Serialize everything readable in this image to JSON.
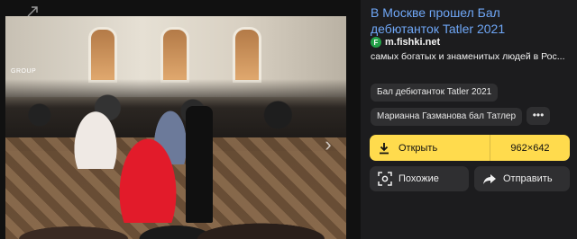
{
  "image": {
    "watermark": "GROUP",
    "next_arrow": "›"
  },
  "result": {
    "title": "В Москве прошел Бал дебютанток Tatler 2021",
    "source": {
      "favicon_letter": "F",
      "domain": "m.fishki.net",
      "favicon_color": "#24a148"
    },
    "snippet": "самых богатых и знаменитых людей в Рос..."
  },
  "tags": [
    "Бал дебютанток Tatler 2021",
    "Марианна Газманова бал Татлер"
  ],
  "more_label": "•••",
  "open": {
    "label": "Открыть",
    "size": "962×642",
    "color": "#ffdb4d"
  },
  "actions": {
    "similar": "Похожие",
    "share": "Отправить"
  },
  "colors": {
    "title_link": "#6fa7f7",
    "panel_bg": "#1c1c1e",
    "button_bg": "#2f2f31"
  }
}
